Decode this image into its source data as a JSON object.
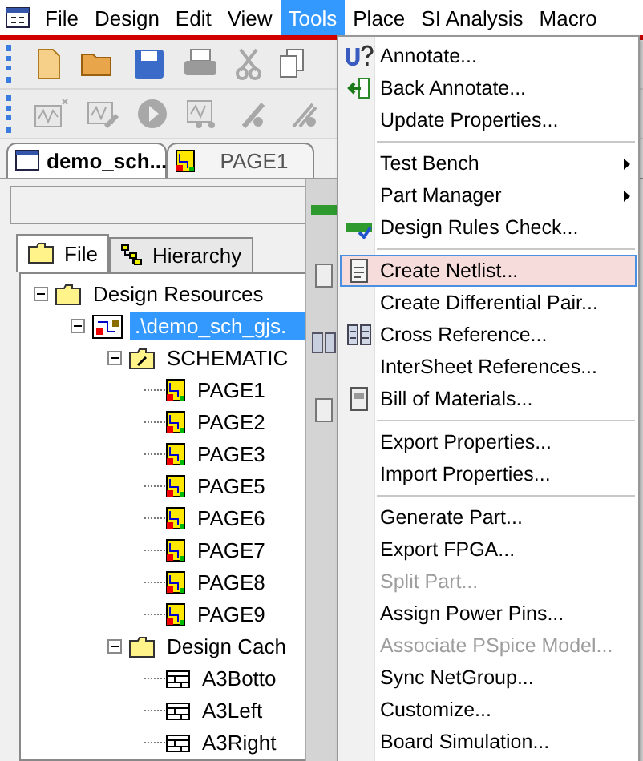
{
  "menu_bar": [
    {
      "label": "File",
      "selected": false
    },
    {
      "label": "Design",
      "selected": false
    },
    {
      "label": "Edit",
      "selected": false
    },
    {
      "label": "View",
      "selected": false
    },
    {
      "label": "Tools",
      "selected": true
    },
    {
      "label": "Place",
      "selected": false
    },
    {
      "label": "SI Analysis",
      "selected": false
    },
    {
      "label": "Macro",
      "selected": false
    }
  ],
  "doc_tabs": [
    {
      "label": "demo_sch...",
      "selected": true,
      "kind": "design"
    },
    {
      "label": "PAGE1",
      "selected": false,
      "kind": "page"
    }
  ],
  "panel_tabs": [
    {
      "label": "File",
      "selected": true,
      "kind": "folder"
    },
    {
      "label": "Hierarchy",
      "selected": false,
      "kind": "hierarchy"
    }
  ],
  "tree": [
    {
      "label": "Design Resources",
      "kind": "folder",
      "expanded": true,
      "selected": false,
      "children": [
        {
          "label": ".\\demo_sch_gjs.",
          "kind": "design",
          "expanded": true,
          "selected": true,
          "children": [
            {
              "label": "SCHEMATIC",
              "kind": "schfolder",
              "expanded": true,
              "selected": false,
              "children": [
                {
                  "label": "PAGE1",
                  "kind": "page",
                  "selected": false
                },
                {
                  "label": "PAGE2",
                  "kind": "page",
                  "selected": false
                },
                {
                  "label": "PAGE3",
                  "kind": "page",
                  "selected": false
                },
                {
                  "label": "PAGE5",
                  "kind": "page",
                  "selected": false
                },
                {
                  "label": "PAGE6",
                  "kind": "page",
                  "selected": false
                },
                {
                  "label": "PAGE7",
                  "kind": "page",
                  "selected": false
                },
                {
                  "label": "PAGE8",
                  "kind": "page",
                  "selected": false
                },
                {
                  "label": "PAGE9",
                  "kind": "page",
                  "selected": false
                }
              ]
            },
            {
              "label": "Design Cach",
              "kind": "folder",
              "expanded": true,
              "selected": false,
              "children": [
                {
                  "label": "A3Botto",
                  "kind": "part",
                  "selected": false
                },
                {
                  "label": "A3Left",
                  "kind": "part",
                  "selected": false
                },
                {
                  "label": "A3Right",
                  "kind": "part",
                  "selected": false
                }
              ]
            }
          ]
        }
      ]
    }
  ],
  "menu": {
    "groups": [
      [
        {
          "label": "Annotate...",
          "kind": "annotate",
          "submenu": false,
          "disabled": false,
          "selected": false
        },
        {
          "label": "Back Annotate...",
          "kind": "back",
          "submenu": false,
          "disabled": false,
          "selected": false
        },
        {
          "label": "Update Properties...",
          "submenu": false,
          "disabled": false,
          "selected": false
        }
      ],
      [
        {
          "label": "Test Bench",
          "submenu": true,
          "disabled": false,
          "selected": false
        },
        {
          "label": "Part Manager",
          "submenu": true,
          "disabled": false,
          "selected": false
        },
        {
          "label": "Design Rules Check...",
          "kind": "drc",
          "submenu": false,
          "disabled": false,
          "selected": false
        }
      ],
      [
        {
          "label": "Create Netlist...",
          "kind": "netlist",
          "submenu": false,
          "disabled": false,
          "selected": true
        },
        {
          "label": "Create Differential Pair...",
          "submenu": false,
          "disabled": false,
          "selected": false
        },
        {
          "label": "Cross Reference...",
          "kind": "crossref",
          "submenu": false,
          "disabled": false,
          "selected": false
        },
        {
          "label": "InterSheet References...",
          "submenu": false,
          "disabled": false,
          "selected": false
        },
        {
          "label": "Bill of Materials...",
          "kind": "bom",
          "submenu": false,
          "disabled": false,
          "selected": false
        }
      ],
      [
        {
          "label": "Export Properties...",
          "submenu": false,
          "disabled": false,
          "selected": false
        },
        {
          "label": "Import Properties...",
          "submenu": false,
          "disabled": false,
          "selected": false
        }
      ],
      [
        {
          "label": "Generate Part...",
          "submenu": false,
          "disabled": false,
          "selected": false
        },
        {
          "label": "Export FPGA...",
          "submenu": false,
          "disabled": false,
          "selected": false
        },
        {
          "label": "Split Part...",
          "submenu": false,
          "disabled": true,
          "selected": false
        },
        {
          "label": "Assign Power Pins...",
          "submenu": false,
          "disabled": false,
          "selected": false
        },
        {
          "label": "Associate PSpice Model...",
          "submenu": false,
          "disabled": true,
          "selected": false
        },
        {
          "label": "Sync NetGroup...",
          "submenu": false,
          "disabled": false,
          "selected": false
        },
        {
          "label": "Customize...",
          "submenu": false,
          "disabled": false,
          "selected": false
        },
        {
          "label": "Board Simulation...",
          "submenu": false,
          "disabled": false,
          "selected": false
        }
      ]
    ]
  }
}
